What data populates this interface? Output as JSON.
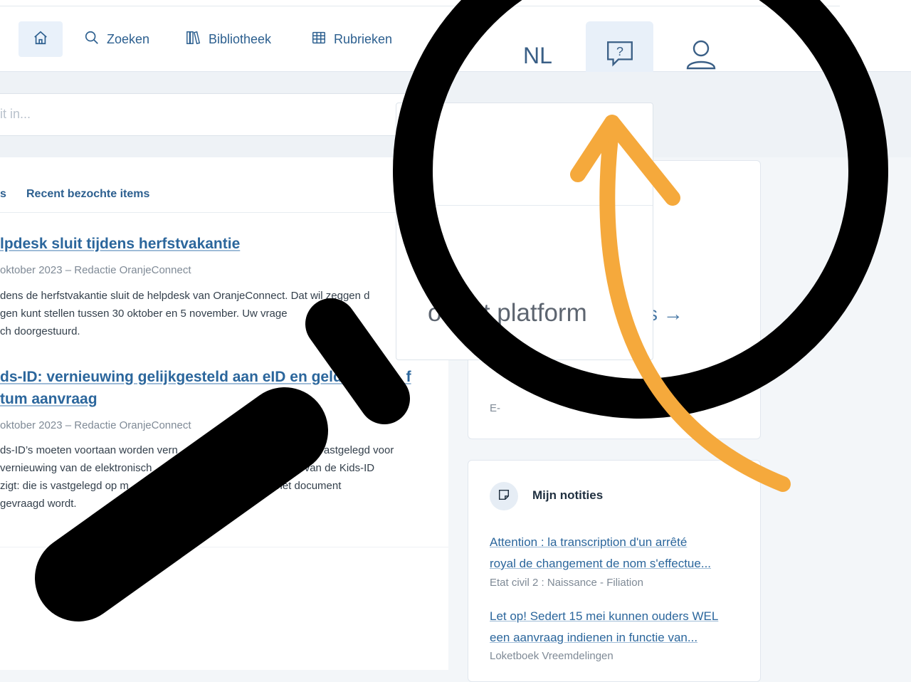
{
  "nav": {
    "home_icon": "home-icon",
    "items": [
      {
        "label": "Zoeken",
        "icon": "search-icon"
      },
      {
        "label": "Bibliotheek",
        "icon": "books-icon"
      },
      {
        "label": "Rubrieken",
        "icon": "grid-icon"
      }
    ],
    "language": "NL",
    "help_icon": "help-chat-icon",
    "user_icon": "user-icon"
  },
  "search": {
    "placeholder": "it in..."
  },
  "tabs": [
    {
      "label": "s"
    },
    {
      "label": "Recent bezochte items"
    }
  ],
  "news": [
    {
      "title": "lpdesk sluit tijdens herfstvakantie",
      "meta": "oktober 2023 – Redactie OranjeConnect",
      "body": [
        "dens de herfstvakantie sluit de helpdesk van OranjeConnect. Dat wil zeggen d",
        "gen kunt stellen tussen 30 oktober en 5 november. Uw vrage          noch ge",
        "ch doorgestuurd."
      ]
    },
    {
      "title": [
        "ds-ID: vernieuwing gelijkgesteld aan eID en geldigh          f",
        "tum aanvraag"
      ],
      "meta": "oktober 2023 – Redactie OranjeConnect",
      "body": [
        "ds-ID’s moeten voortaan worden vern                                    als die vastgelegd voor",
        "vernieuwing van de elektronisch                               e geldigheid van de Kids-ID",
        "zigt: die is vastgelegd op m                            atum waarop het document",
        "gevraagd wordt."
      ]
    }
  ],
  "help_dropdown": {
    "link": "ot het platform"
  },
  "side_card": {
    "more": "s →",
    "email": "E-"
  },
  "notes": {
    "title": "Mijn notities",
    "icon": "note-icon",
    "items": [
      {
        "title": [
          "Attention : la transcription d'un arrêté",
          "royal de changement de nom s'effectue..."
        ],
        "category": "Etat civil 2 : Naissance - Filiation"
      },
      {
        "title": [
          "Let op! Sedert 15 mei kunnen ouders WEL",
          "een aanvraag indienen in functie van..."
        ],
        "category": "Loketboek Vreemdelingen"
      }
    ]
  },
  "overlay": {
    "magnifier_icon": "magnifying-glass-icon",
    "arrow_icon": "arrow-icon",
    "arrow_color": "#f5a93c"
  }
}
